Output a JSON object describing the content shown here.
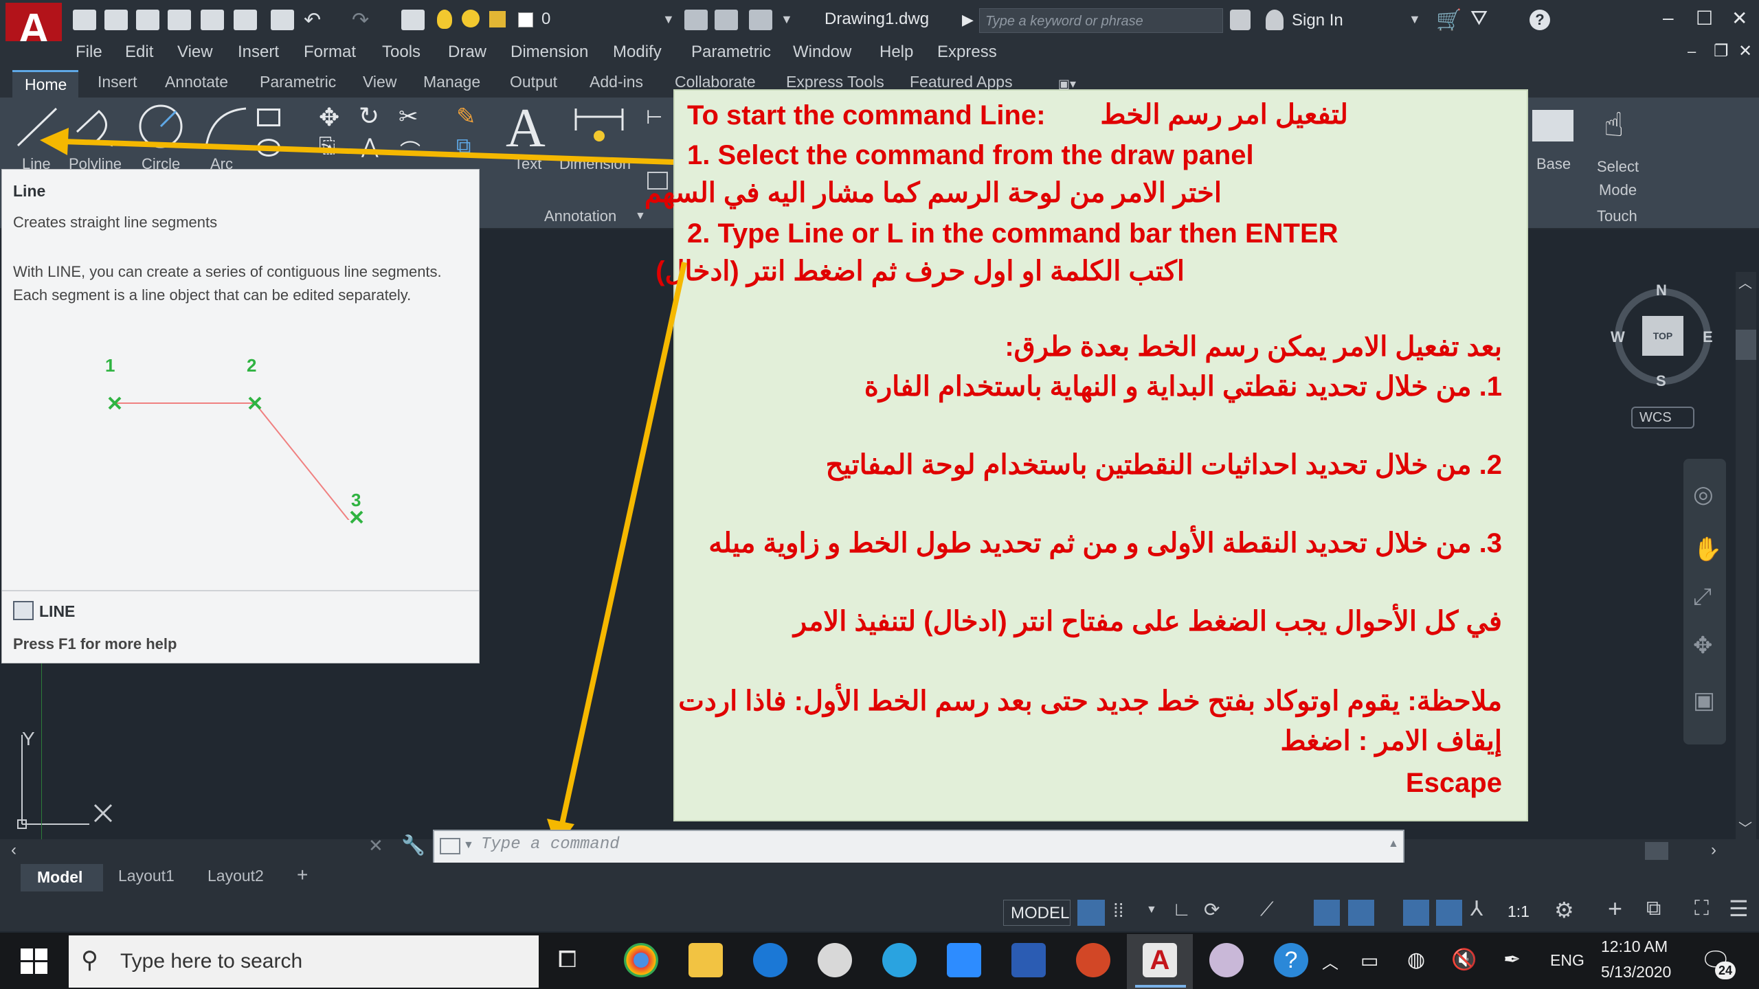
{
  "titlebar": {
    "document_title": "Drawing1.dwg",
    "layer_value": "0",
    "search_placeholder": "Type a keyword or phrase",
    "sign_in": "Sign In",
    "logo_letter": "A"
  },
  "menu": [
    "File",
    "Edit",
    "View",
    "Insert",
    "Format",
    "Tools",
    "Draw",
    "Dimension",
    "Modify",
    "Parametric",
    "Window",
    "Help",
    "Express"
  ],
  "ribbon_tabs": [
    "Home",
    "Insert",
    "Annotate",
    "Parametric",
    "View",
    "Manage",
    "Output",
    "Add-ins",
    "Collaborate",
    "Express Tools",
    "Featured Apps"
  ],
  "ribbon": {
    "tools": [
      "Line",
      "Polyline",
      "Circle",
      "Arc"
    ],
    "text_label": "Text",
    "dimension_label": "Dimension",
    "annotation_panel": "Annotation",
    "base_label": "Base",
    "select_mode_label": "Select\nMode",
    "touch_label": "Touch"
  },
  "tooltip": {
    "title": "Line",
    "description": "Creates straight line segments",
    "body": "With LINE, you can create a series of contiguous line segments. Each segment is a line object that can be edited separately.",
    "points": [
      "1",
      "2",
      "3"
    ],
    "command": "LINE",
    "help": "Press F1 for more help"
  },
  "annotation": {
    "heading_en": "To start the command Line:",
    "heading_ar": "لتفعيل امر رسم الخط",
    "step1_en": "1. Select the command from the draw panel",
    "step1_ar": "اختر الامر من لوحة الرسم كما مشار اليه في السهم",
    "step2_en": "2. Type Line or L in the command bar then ENTER",
    "step2_ar": "اكتب الكلمة او اول حرف ثم اضغط انتر (ادخال)",
    "methods_intro": "بعد تفعيل الامر يمكن رسم الخط بعدة طرق:",
    "method1": "1. من خلال تحديد نقطتي البداية و النهاية باستخدام الفارة",
    "method2": "2. من خلال تحديد احداثيات النقطتين باستخدام لوحة المفاتيح",
    "method3": "3. من خلال تحديد النقطة الأولى و من ثم تحديد طول الخط و زاوية ميله",
    "enter_note": "في كل الأحوال يجب الضغط على مفتاح انتر (ادخال) لتنفيذ الامر",
    "note_line1": "ملاحظة: يقوم اوتوكاد بفتح خط جديد حتى بعد رسم الخط الأول: فاذا اردت",
    "note_line2": "إيقاف الامر : اضغط",
    "escape": "Escape"
  },
  "viewcube": {
    "n": "N",
    "s": "S",
    "e": "E",
    "w": "W",
    "top": "TOP",
    "wcs": "WCS"
  },
  "ucs": {
    "y": "Y"
  },
  "command_line": {
    "placeholder": "Type a command"
  },
  "layout_tabs": [
    "Model",
    "Layout1",
    "Layout2"
  ],
  "status": {
    "model": "MODEL",
    "scale": "1:1"
  },
  "taskbar": {
    "search": "Type here to search",
    "lang": "ENG",
    "time": "12:10 AM",
    "date": "5/13/2020",
    "notification_count": "24"
  },
  "colors": {
    "annotation_bg": "#e2efd9",
    "annotation_text": "#e00000",
    "arrow": "#f5b800",
    "ui_dark": "#2a3139",
    "ribbon": "#3c4651"
  }
}
